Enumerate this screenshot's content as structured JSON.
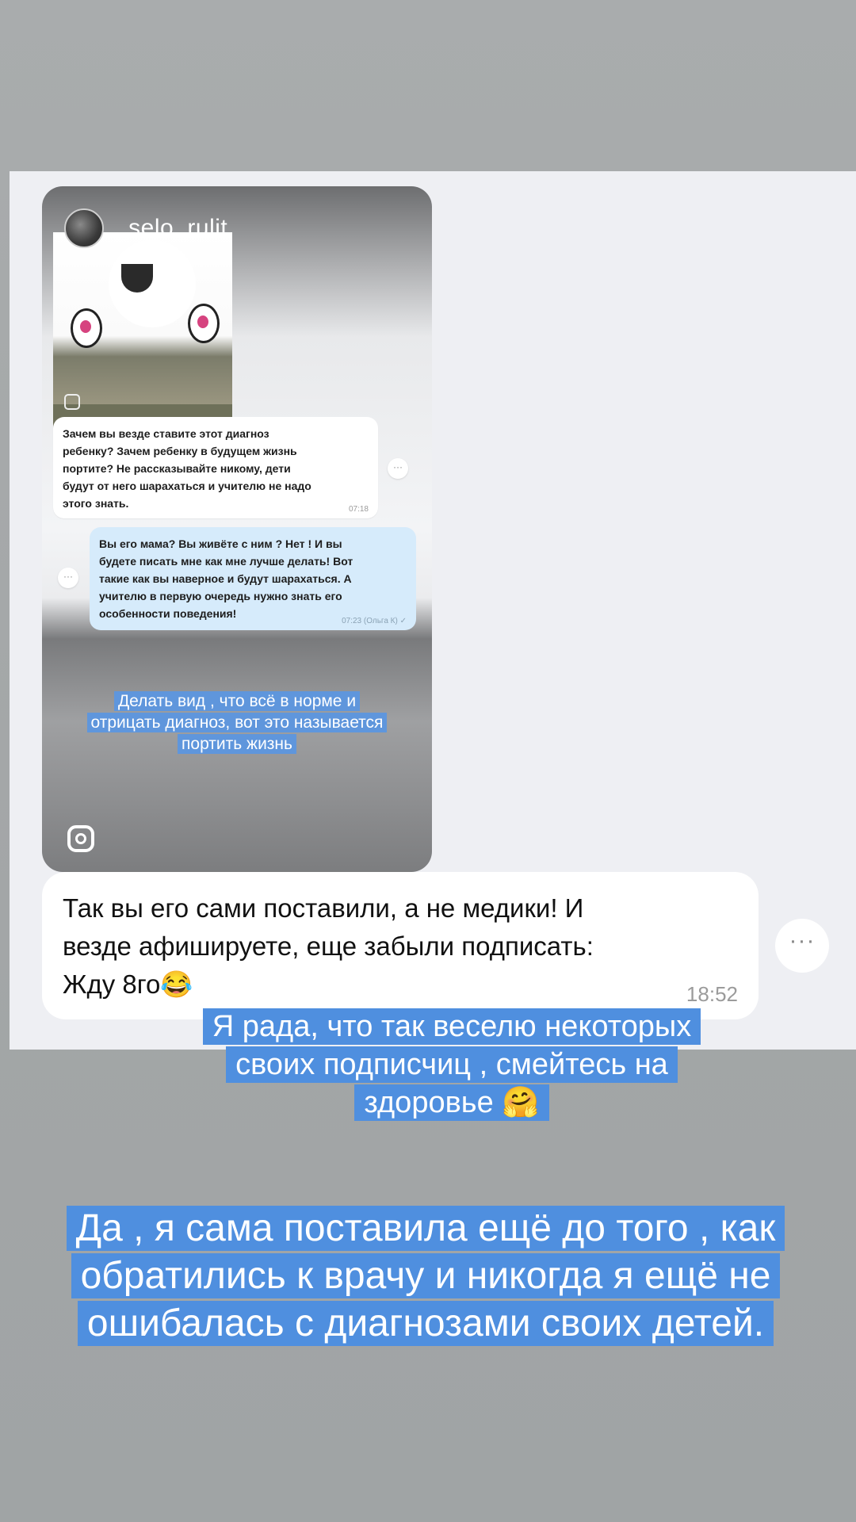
{
  "story": {
    "username": "_selo_rulit",
    "incoming_message": "Зачем вы везде ставите этот диагноз\nребенку?  Зачем ребенку в будущем жизнь\nпортите? Не рассказывайте никому, дети\nбудут от него шарахаться и учителю не надо\nэтого знать.",
    "incoming_time": "07:18",
    "outgoing_message": "Вы его мама? Вы живёте с ним ? Нет ! И вы\nбудете писать мне как мне лучше делать! Вот\nтакие как вы наверное и будут шарахаться. А\nучителю в первую очередь нужно знать его\nособенности поведения!",
    "outgoing_time": "07:23 (Ольга К) ✓",
    "caption": "Делать вид , что всё в норме и отрицать диагноз, вот это называется портить жизнь",
    "more_icon": "···"
  },
  "reply": {
    "text": "Так вы его сами поставили, а не медики! И\nвезде афишируете, еще забыли подписать:\nЖду 8го😂",
    "time": "18:52",
    "more_icon": "···"
  },
  "captions": {
    "first": "Я рада, что так веселю некоторых своих подписчиц , смейтесь на здоровье 🤗",
    "second": "Да , я сама поставила ещё до того , как обратились к врачу и никогда я ещё не ошибалась с диагнозами своих детей."
  }
}
